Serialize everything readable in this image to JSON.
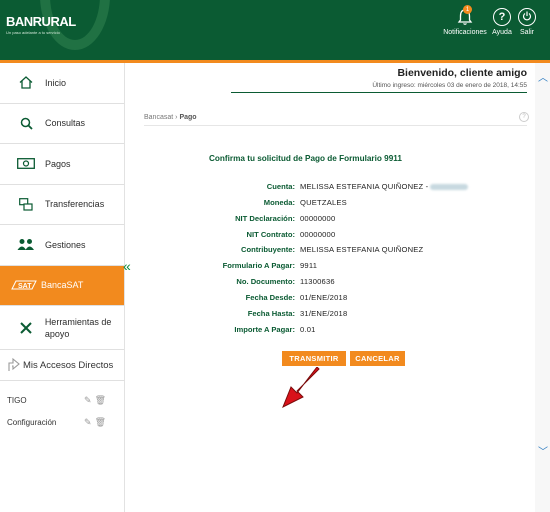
{
  "header": {
    "logo_text": "BANRURAL",
    "logo_tagline": "Un paso adelante a tu servicio",
    "notifications_label": "Notificaciones",
    "notifications_count": "1",
    "help_label": "Ayuda",
    "help_glyph": "?",
    "exit_label": "Salir",
    "brand_green": "#0b5b33",
    "accent_orange": "#f28a1e"
  },
  "sidebar": {
    "items": [
      {
        "label": "Inicio",
        "icon": "home-icon"
      },
      {
        "label": "Consultas",
        "icon": "search-icon"
      },
      {
        "label": "Pagos",
        "icon": "money-icon"
      },
      {
        "label": "Transferencias",
        "icon": "transfer-icon"
      },
      {
        "label": "Gestiones",
        "icon": "people-icon"
      },
      {
        "label": "BancaSAT",
        "icon": "sat-logo-icon",
        "active": true
      },
      {
        "label": "Herramientas de apoyo",
        "icon": "tools-icon"
      }
    ],
    "accesos_label": "Mis Accesos Directos",
    "shortcuts": [
      {
        "label": "TIGO"
      },
      {
        "label": "Configuración"
      }
    ]
  },
  "main": {
    "welcome": "Bienvenido, cliente amigo",
    "last_login": "Último ingreso: miércoles 03 de enero de 2018, 14:55",
    "breadcrumb_root": "Bancasat",
    "breadcrumb_sep": "›",
    "breadcrumb_current": "Pago",
    "confirm_title": "Confirma tu solicitud de Pago de Formulario 9911",
    "fields": [
      {
        "label": "Cuenta:",
        "value": "MELISSA ESTEFANIA QUIÑONEZ -"
      },
      {
        "label": "Moneda:",
        "value": "QUETZALES"
      },
      {
        "label": "NIT Declaración:",
        "value": "00000000"
      },
      {
        "label": "NIT Contrato:",
        "value": "00000000"
      },
      {
        "label": "Contribuyente:",
        "value": "MELISSA ESTEFANIA QUIÑONEZ"
      },
      {
        "label": "Formulario A Pagar:",
        "value": "9911"
      },
      {
        "label": "No. Documento:",
        "value": "11300636"
      },
      {
        "label": "Fecha Desde:",
        "value": "01/ENE/2018"
      },
      {
        "label": "Fecha Hasta:",
        "value": "31/ENE/2018"
      },
      {
        "label": "Importe A Pagar:",
        "value": "0.01"
      }
    ],
    "transmit_label": "TRANSMITIR",
    "cancel_label": "CANCELAR"
  }
}
